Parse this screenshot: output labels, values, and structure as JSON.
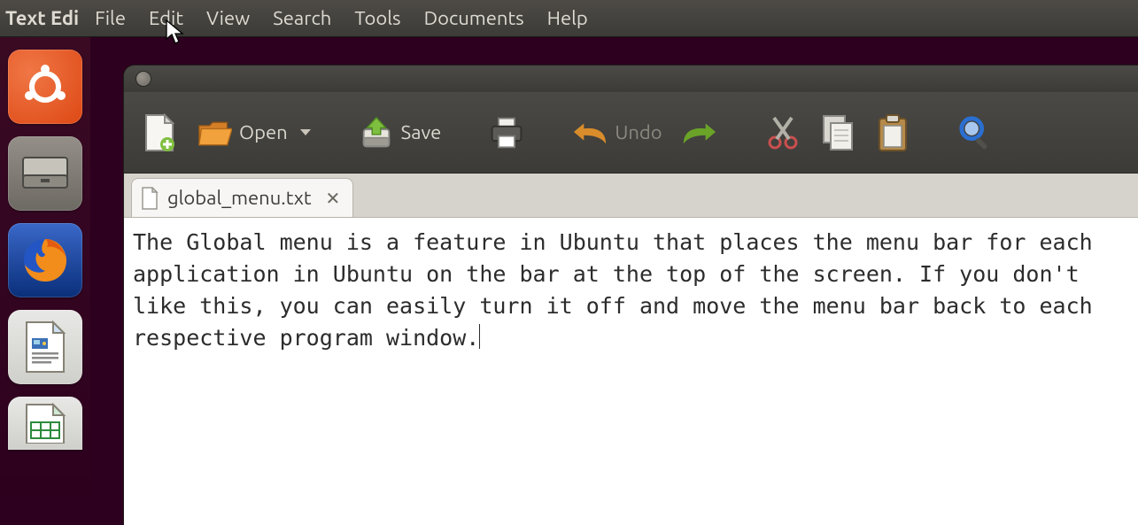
{
  "global_menu": {
    "app_name": "Text Edi",
    "items": [
      "File",
      "Edit",
      "View",
      "Search",
      "Tools",
      "Documents",
      "Help"
    ]
  },
  "launcher": {
    "items": [
      {
        "name": "ubuntu-dash",
        "style": "ubuntu"
      },
      {
        "name": "files",
        "style": "files"
      },
      {
        "name": "firefox",
        "style": "firefox"
      },
      {
        "name": "libreoffice-writer",
        "style": "writer"
      },
      {
        "name": "libreoffice-calc",
        "style": "calc"
      }
    ]
  },
  "toolbar": {
    "open_label": "Open",
    "save_label": "Save",
    "undo_label": "Undo"
  },
  "tab": {
    "filename": "global_menu.txt"
  },
  "editor": {
    "content": "The Global menu is a feature in Ubuntu that places the menu bar for each application in Ubuntu on the bar at the top of the screen. If you don't like this, you can easily turn it off and move the menu bar back to each respective program window."
  }
}
